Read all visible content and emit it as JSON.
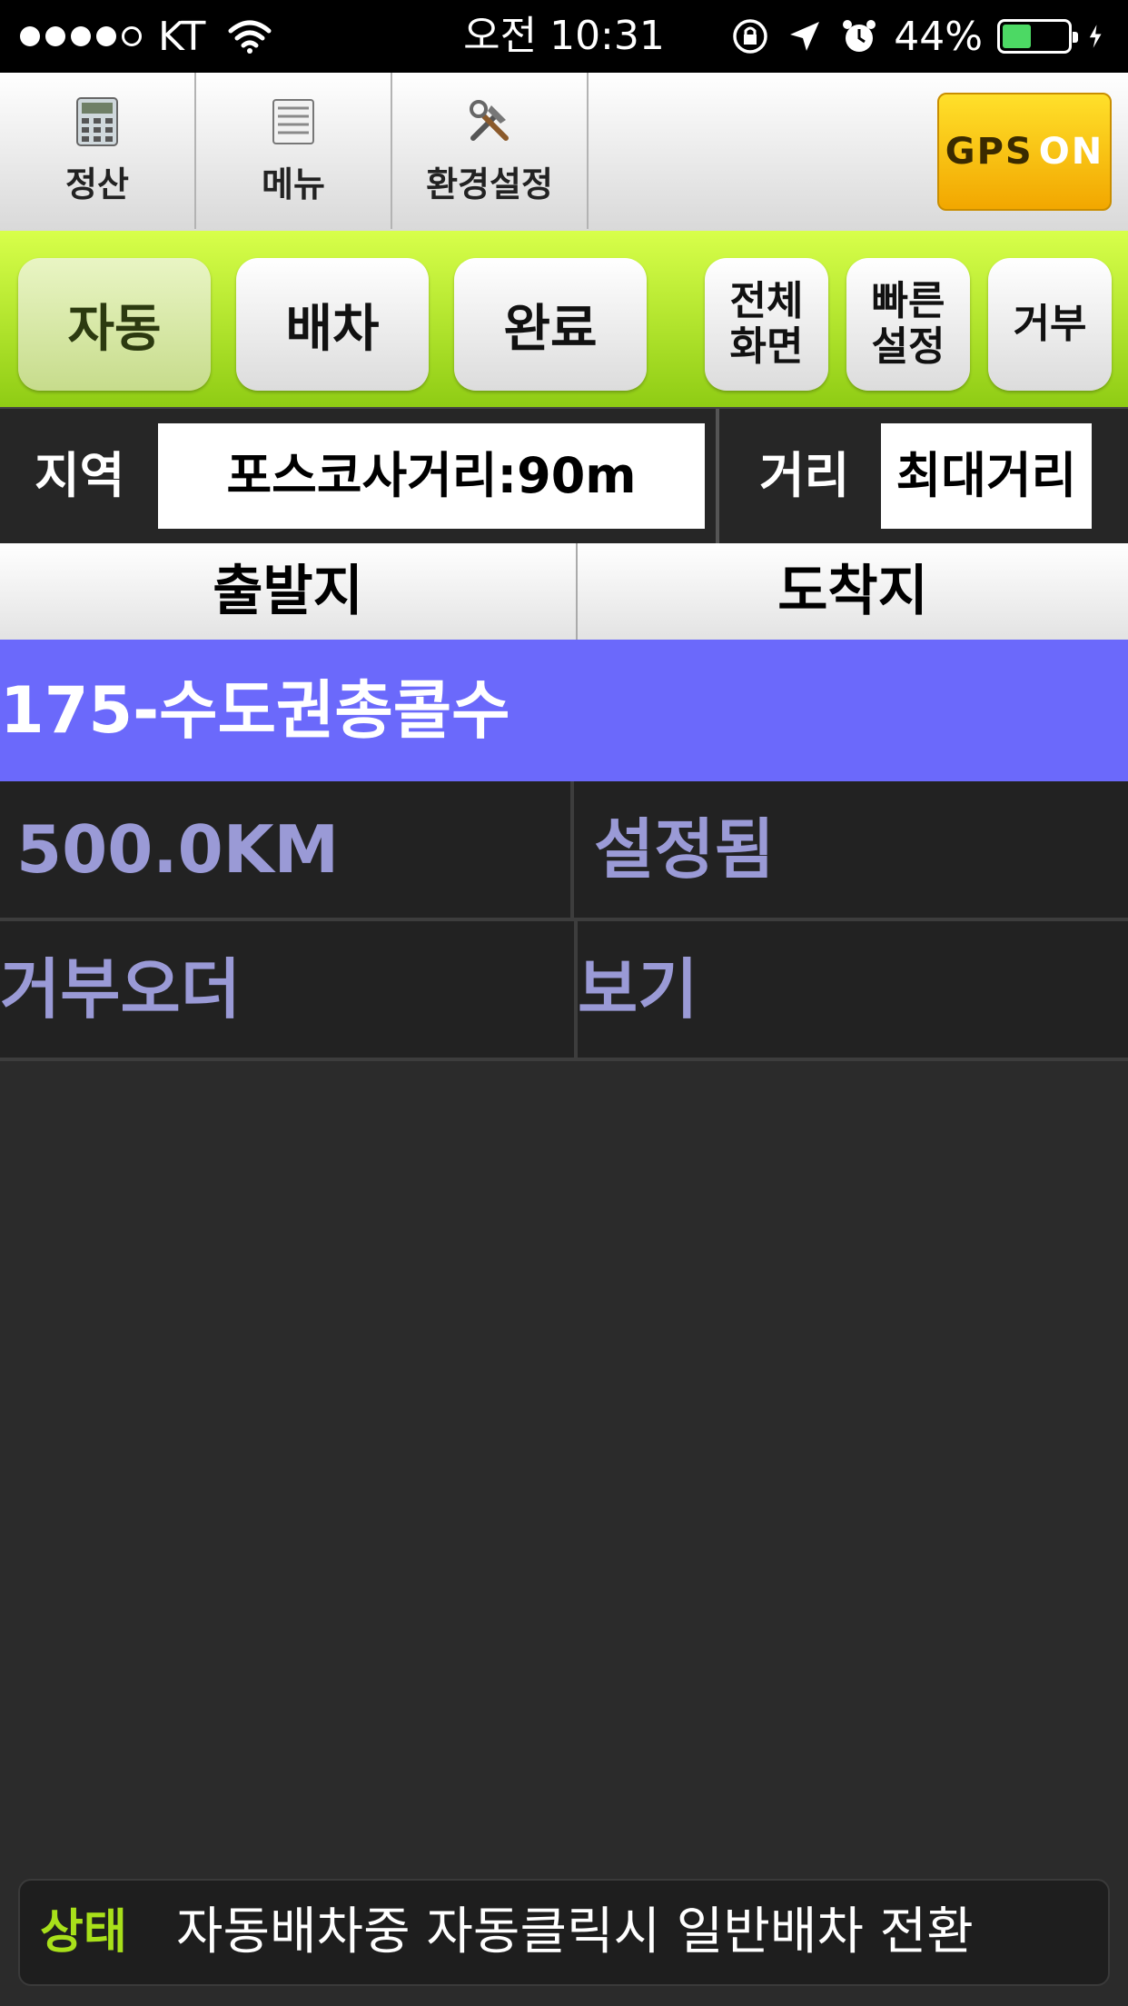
{
  "status_bar": {
    "carrier": "KT",
    "signal_bars_filled": 4,
    "signal_bars_total": 5,
    "time": "오전 10:31",
    "battery": "44%",
    "battery_level": 0.44
  },
  "toolbar": {
    "settle_label": "정산",
    "menu_label": "메뉴",
    "settings_label": "환경설정",
    "gps_label": "GPS",
    "gps_state": "ON"
  },
  "modes": {
    "auto": "자동",
    "dispatch": "배차",
    "complete": "완료",
    "fullscreen_line1": "전체",
    "fullscreen_line2": "화면",
    "quick_line1": "빠른",
    "quick_line2": "설정",
    "reject": "거부"
  },
  "area": {
    "region_label": "지역",
    "region_value": "포스코사거리:90m",
    "distance_label": "거리",
    "distance_value": "최대거리"
  },
  "table": {
    "headers": [
      "출발지",
      "도착지"
    ],
    "highlight": "175-수도권총콜수",
    "rows": [
      [
        "500.0KM",
        "설정됨"
      ],
      [
        "거부오더",
        "보기"
      ]
    ]
  },
  "footer": {
    "tag": "상태",
    "message": "자동배차중  자동클릭시 일반배차 전환"
  },
  "colors": {
    "accent_green": "#a8e01a",
    "highlight_row": "#6b69fb",
    "gps_yellow": "#f2b400"
  }
}
